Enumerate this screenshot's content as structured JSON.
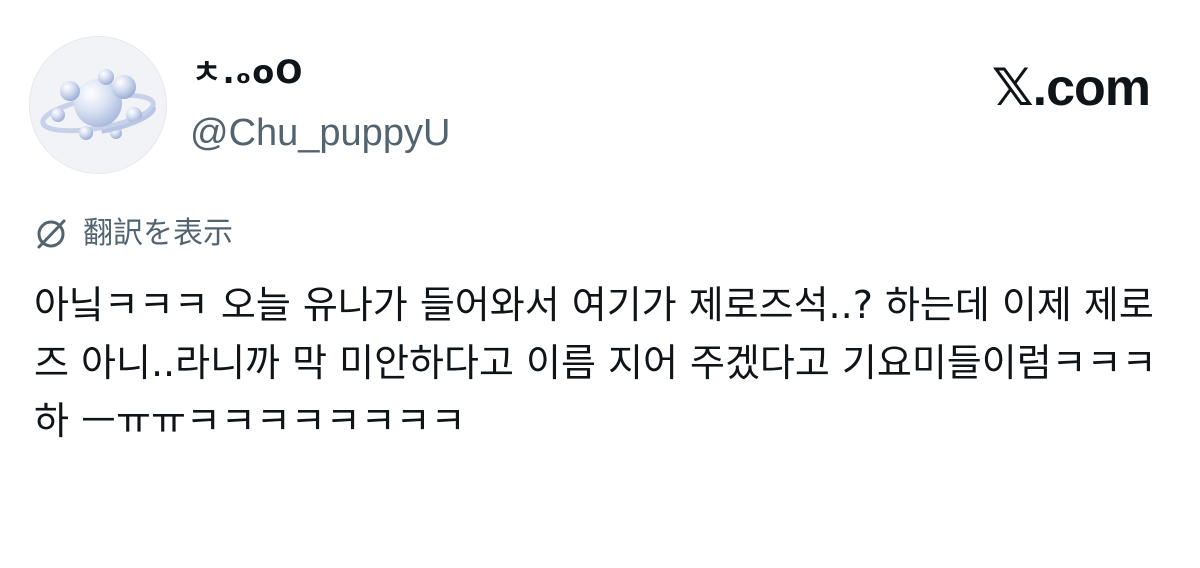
{
  "author": {
    "display_name": "ㅊ.ₒoO",
    "handle": "@Chu_puppyU",
    "avatar_icon": "planet-bubbles-avatar"
  },
  "brand": {
    "label": "𝕏.com"
  },
  "translate": {
    "icon": "translate-icon",
    "label": "翻訳を表示"
  },
  "tweet": {
    "text": "아닠ㅋㅋㅋ 오늘 유나가 들어와서 여기가 제로즈석..? 하는데 이제 제로즈 아니..라니까 막 미안하다고 이름 지어 주겠다고 기요미들이럼ㅋㅋㅋ하 ㅡㅠㅠㅋㅋㅋㅋㅋㅋㅋㅋ"
  },
  "colors": {
    "text": "#0f1419",
    "secondary": "#536471",
    "background": "#ffffff"
  }
}
